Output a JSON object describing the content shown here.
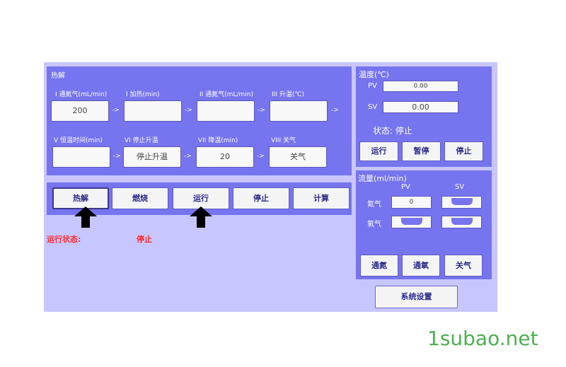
{
  "pyrolysis": {
    "title": "热解",
    "labels": [
      "I 通氮气(mL/min)",
      "I 加热(min)",
      "II 通氮气(mL/min)",
      "III 升温(℃)",
      "V 恒温时间(min)",
      "VI 停止升温",
      "VII 降温(min)",
      "VIII 关气"
    ],
    "values": [
      "200",
      "",
      "",
      "",
      "",
      "停止升温",
      "20",
      "关气"
    ],
    "arrow": "->"
  },
  "temperature": {
    "title": "温度(℃)",
    "pv_label": "PV",
    "pv_value": "0.00",
    "sv_label": "SV",
    "sv_value": "0.00",
    "state_label": "状态: 停止",
    "buttons": [
      "运行",
      "暂停",
      "停止"
    ]
  },
  "flow": {
    "title": "流量(ml/min)",
    "pv_header": "PV",
    "sv_header": "SV",
    "rows": [
      {
        "label": "氮气",
        "pv": "0",
        "sv": ""
      },
      {
        "label": "氧气",
        "pv": "",
        "sv": ""
      }
    ],
    "buttons": [
      "通氮",
      "通氧",
      "关气"
    ]
  },
  "mode_buttons": [
    "热解",
    "燃烧",
    "运行",
    "停止",
    "计算"
  ],
  "run_status": {
    "label": "运行状态:",
    "value": "停止"
  },
  "system_button": "系统设置",
  "watermark": "1subao.net",
  "colors": {
    "panel": "#7674ee",
    "outer": "#c8c6ff",
    "status": "#ff2b2b",
    "watermark": "#4caf50"
  }
}
